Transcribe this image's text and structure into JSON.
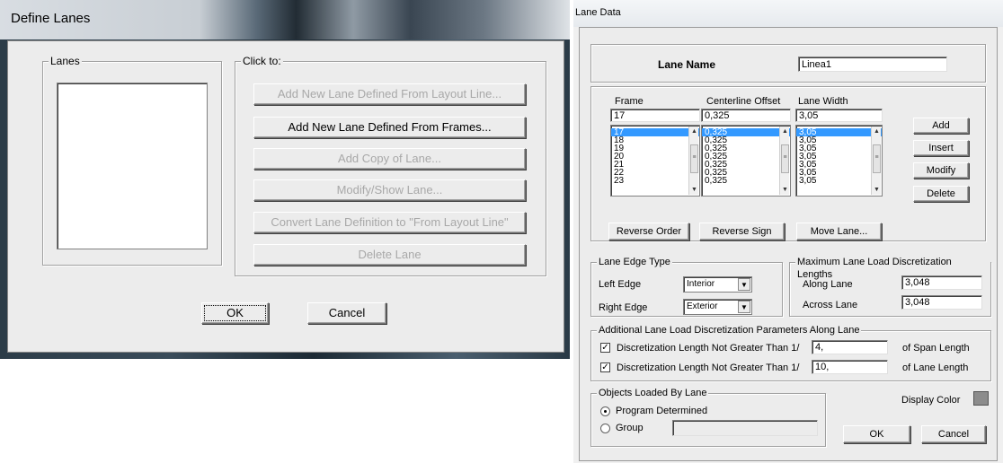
{
  "define_lanes": {
    "title": "Define Lanes",
    "lanes_group": "Lanes",
    "click_group": "Click to:",
    "buttons": {
      "add_from_layout": "Add New Lane Defined From Layout Line...",
      "add_from_frames": "Add New Lane Defined From Frames...",
      "add_copy": "Add Copy of Lane...",
      "modify_show": "Modify/Show Lane...",
      "convert": "Convert Lane Definition to \"From Layout Line\"",
      "delete": "Delete Lane",
      "ok": "OK",
      "cancel": "Cancel"
    }
  },
  "lane_data": {
    "title": "Lane Data",
    "lane_name_label": "Lane Name",
    "lane_name_value": "Linea1",
    "columns": {
      "frame": "Frame",
      "offset": "Centerline Offset",
      "width": "Lane Width"
    },
    "inputs": {
      "frame": "17",
      "offset": "0,325",
      "width": "3,05"
    },
    "frames": [
      "17",
      "18",
      "19",
      "20",
      "21",
      "22",
      "23"
    ],
    "offsets": [
      "0,325",
      "0,325",
      "0,325",
      "0,325",
      "0,325",
      "0,325",
      "0,325"
    ],
    "widths": [
      "3,05",
      "3,05",
      "3,05",
      "3,05",
      "3,05",
      "3,05",
      "3,05"
    ],
    "side_buttons": {
      "add": "Add",
      "insert": "Insert",
      "modify": "Modify",
      "delete": "Delete"
    },
    "row_buttons": {
      "reverse_order": "Reverse Order",
      "reverse_sign": "Reverse Sign",
      "move_lane": "Move Lane..."
    },
    "edge_type": {
      "title": "Lane Edge Type",
      "left_label": "Left Edge",
      "left_value": "Interior",
      "right_label": "Right Edge",
      "right_value": "Exterior"
    },
    "max_disc": {
      "title": "Maximum Lane Load Discretization Lengths",
      "along_label": "Along Lane",
      "along_value": "3,048",
      "across_label": "Across Lane",
      "across_value": "3,048"
    },
    "additional": {
      "title": "Additional Lane Load Discretization Parameters Along Lane",
      "row1_label": "Discretization Length Not Greater Than  1/",
      "row1_value": "4,",
      "row1_suffix": "of Span Length",
      "row2_label": "Discretization Length Not Greater Than  1/",
      "row2_value": "10,",
      "row2_suffix": "of Lane Length"
    },
    "objects": {
      "title": "Objects Loaded By Lane",
      "program_label": "Program Determined",
      "group_label": "Group"
    },
    "display_color_label": "Display Color",
    "display_color": "#8c8c8c",
    "ok": "OK",
    "cancel": "Cancel"
  }
}
